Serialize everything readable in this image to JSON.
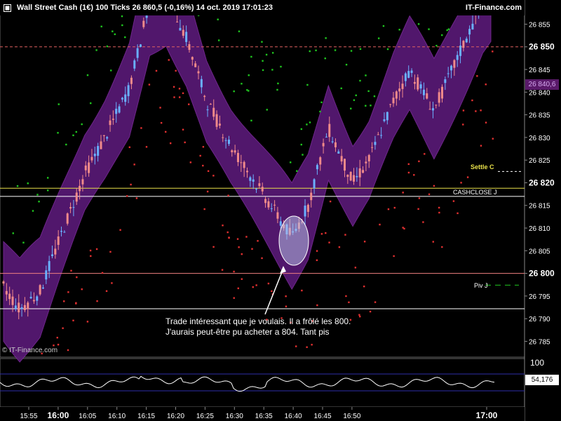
{
  "header": {
    "title": "Wall Street Cash (1€)    100 Ticks    26 860,5 (-0,16%)    14 oct. 2019 17:01:23",
    "brand": "IT-Finance.com"
  },
  "copyright": "© IT-Finance.com",
  "annotation": {
    "line1": "Trade intéressant que je voulais. Il a frôlé les 800.",
    "line2": "J'aurais peut-être pu acheter a 804. Tant pis"
  },
  "levels": {
    "settle": "Settle C",
    "cashclose": "CASHCLOSE J",
    "piv": "Piv J"
  },
  "current_price_label": "26 840,6",
  "indicator": {
    "top_label": "100",
    "value_label": "54,176"
  },
  "colors": {
    "background": "#000000",
    "band_fill": "#5a1a78",
    "band_edge": "#7a2a9a",
    "candle_up": "#6ab0ff",
    "candle_down": "#f08a8a",
    "dots_green": "#1fc51f",
    "dots_red": "#e03030",
    "settle_line": "#e8e04a",
    "level_line": "#ffffff",
    "level_800": "#f08080",
    "ref_dashed": "#e06060",
    "indicator_line": "#ffffff",
    "indicator_band": "#2e2ea8"
  },
  "chart_data": {
    "type": "candlestick",
    "ylim": [
      26782,
      26862
    ],
    "y_ticks": [
      "26 785",
      "26 790",
      "26 795",
      "26 800",
      "26 805",
      "26 810",
      "26 815",
      "26 820",
      "26 825",
      "26 830",
      "26 835",
      "26 840",
      "26 845",
      "26 850",
      "26 855"
    ],
    "y_tick_values": [
      26785,
      26790,
      26795,
      26800,
      26805,
      26810,
      26815,
      26820,
      26825,
      26830,
      26835,
      26840,
      26845,
      26850,
      26855
    ],
    "major_y_ticks": [
      "26 800",
      "26 850",
      "26 820"
    ],
    "x_ticks": [
      "15:55",
      "16:00",
      "16:05",
      "16:10",
      "16:15",
      "16:20",
      "16:25",
      "16:30",
      "16:35",
      "16:40",
      "16:45",
      "16:50",
      "17:00"
    ],
    "major_x_ticks": [
      "16:00",
      "17:00"
    ],
    "horizontal_levels": [
      {
        "label": "Settle C",
        "value": 26818.8,
        "color": "settle"
      },
      {
        "label": "CASHCLOSE J",
        "value": 26817.0,
        "color": "white"
      },
      {
        "label": "800",
        "value": 26800.0,
        "color": "pink"
      },
      {
        "label": "Piv J",
        "value": 26792.2,
        "color": "white"
      },
      {
        "label": "",
        "value": 26850.0,
        "color": "dashed"
      }
    ],
    "price_path": [
      {
        "t": 0,
        "v": 26797
      },
      {
        "t": 4,
        "v": 26792
      },
      {
        "t": 9,
        "v": 26796
      },
      {
        "t": 14,
        "v": 26808
      },
      {
        "t": 20,
        "v": 26822
      },
      {
        "t": 25,
        "v": 26830
      },
      {
        "t": 31,
        "v": 26841
      },
      {
        "t": 36,
        "v": 26860
      },
      {
        "t": 40,
        "v": 26862
      },
      {
        "t": 45,
        "v": 26852
      },
      {
        "t": 50,
        "v": 26838
      },
      {
        "t": 56,
        "v": 26828
      },
      {
        "t": 62,
        "v": 26820
      },
      {
        "t": 68,
        "v": 26812
      },
      {
        "t": 71,
        "v": 26808
      },
      {
        "t": 75,
        "v": 26815
      },
      {
        "t": 80,
        "v": 26832
      },
      {
        "t": 86,
        "v": 26820
      },
      {
        "t": 90,
        "v": 26825
      },
      {
        "t": 96,
        "v": 26838
      },
      {
        "t": 100,
        "v": 26845
      },
      {
        "t": 106,
        "v": 26836
      },
      {
        "t": 112,
        "v": 26848
      },
      {
        "t": 118,
        "v": 26860
      },
      {
        "t": 120,
        "v": 26862
      }
    ],
    "indicator": {
      "name": "",
      "upper_band": 100,
      "value": 54.176
    },
    "grid": false
  }
}
